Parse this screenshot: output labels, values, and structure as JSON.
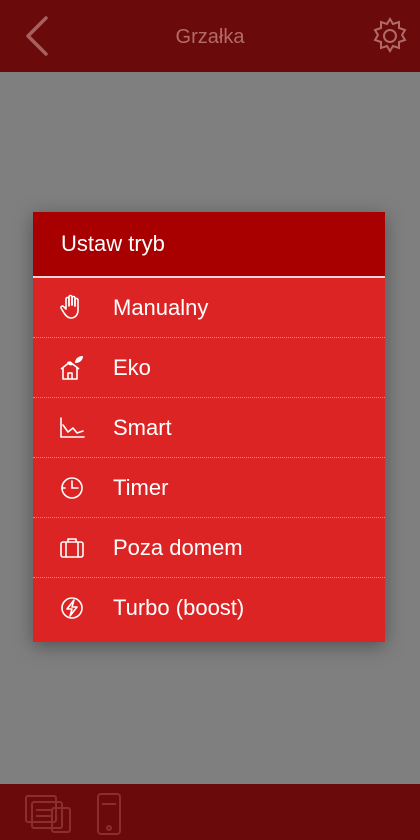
{
  "header": {
    "title": "Grzałka"
  },
  "dialog": {
    "title": "Ustaw tryb",
    "items": [
      {
        "label": "Manualny",
        "icon": "hand-icon"
      },
      {
        "label": "Eko",
        "icon": "eco-house-icon"
      },
      {
        "label": "Smart",
        "icon": "chart-icon"
      },
      {
        "label": "Timer",
        "icon": "timer-icon"
      },
      {
        "label": "Poza domem",
        "icon": "suitcase-icon"
      },
      {
        "label": "Turbo (boost)",
        "icon": "boost-icon"
      }
    ]
  },
  "bottom_nav": {
    "items": [
      {
        "icon": "devices-icon"
      },
      {
        "icon": "phone-icon"
      }
    ]
  },
  "colors": {
    "header_bg": "#6a0a0a",
    "dialog_bg": "#dd2424",
    "dialog_header_bg": "#a80000",
    "backdrop": "#808080"
  }
}
